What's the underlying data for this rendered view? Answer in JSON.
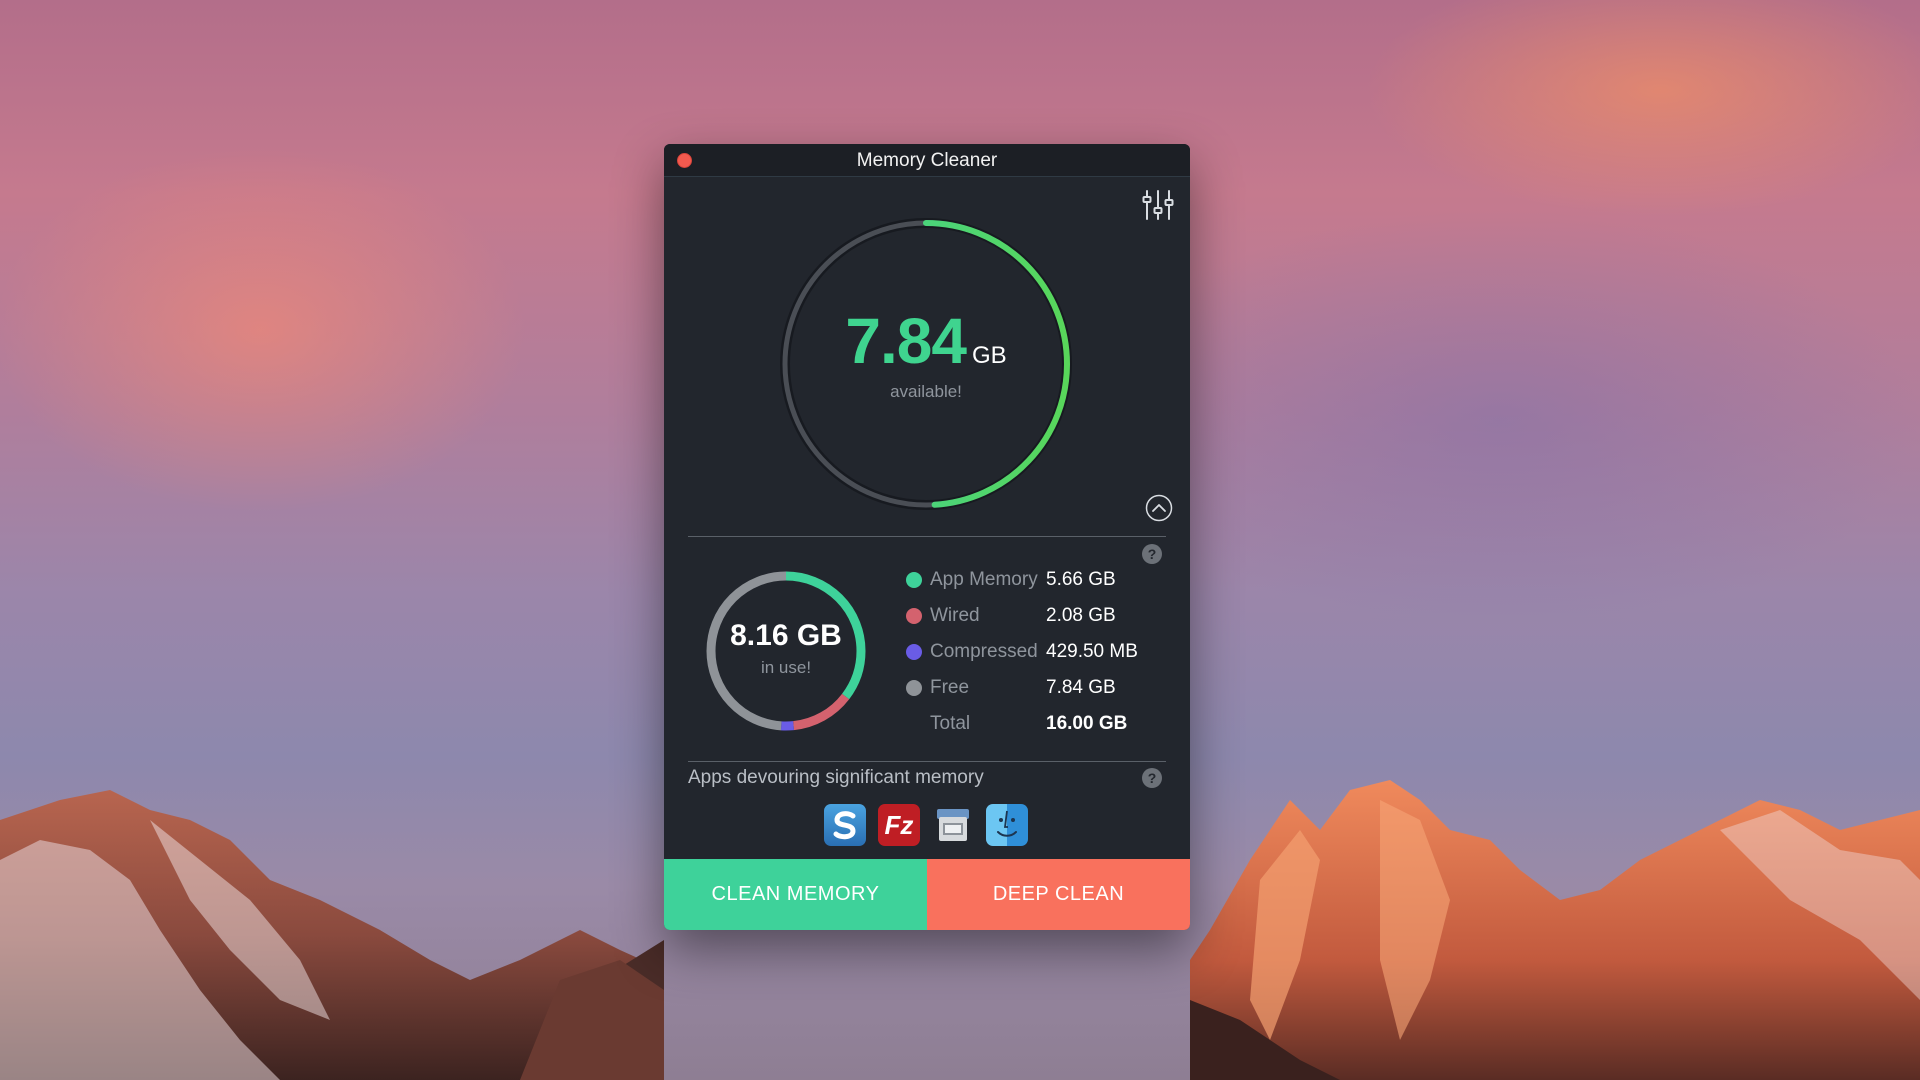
{
  "window": {
    "title": "Memory Cleaner"
  },
  "available": {
    "value": "7.84",
    "unit": "GB",
    "caption": "available!",
    "fraction": 0.49
  },
  "usage": {
    "value": "8.16 GB",
    "caption": "in use!"
  },
  "breakdown": [
    {
      "label": "App Memory",
      "value": "5.66 GB",
      "color": "#3ed29a",
      "gb": 5.66
    },
    {
      "label": "Wired",
      "value": "2.08 GB",
      "color": "#d4626e",
      "gb": 2.08
    },
    {
      "label": "Compressed",
      "value": "429.50 MB",
      "color": "#6a5ce6",
      "gb": 0.42
    },
    {
      "label": "Free",
      "value": "7.84 GB",
      "color": "#8f9398",
      "gb": 7.84
    }
  ],
  "total": {
    "label": "Total",
    "value": "16.00 GB"
  },
  "apps": {
    "label": "Apps devouring significant memory",
    "items": [
      {
        "icon": "simplenote-icon"
      },
      {
        "icon": "filezilla-icon",
        "text": "Fz"
      },
      {
        "icon": "preview-icon"
      },
      {
        "icon": "finder-icon"
      }
    ]
  },
  "buttons": {
    "clean": "CLEAN MEMORY",
    "deep": "DEEP CLEAN"
  },
  "help": "?"
}
